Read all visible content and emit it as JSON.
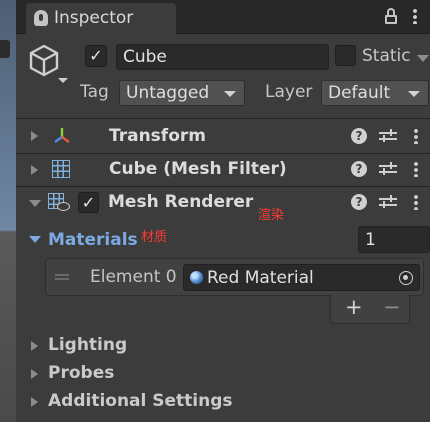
{
  "window": {
    "tab_title": "Inspector"
  },
  "header": {
    "active": true,
    "object_name": "Cube",
    "static_label": "Static",
    "static_checked": false,
    "tag_label": "Tag",
    "tag_value": "Untagged",
    "layer_label": "Layer",
    "layer_value": "Default"
  },
  "components": [
    {
      "title": "Transform",
      "icon": "transform-axes-icon"
    },
    {
      "title": "Cube (Mesh Filter)",
      "icon": "mesh-grid-icon"
    },
    {
      "title": "Mesh Renderer",
      "icon": "mesh-renderer-icon",
      "enabled": true,
      "annotation": "渲染"
    }
  ],
  "materials": {
    "label": "Materials",
    "annotation": "材质",
    "count": "1",
    "element_label": "Element 0",
    "element_value": "Red Material",
    "add_symbol": "+",
    "remove_symbol": "−"
  },
  "sections": [
    "Lighting",
    "Probes",
    "Additional Settings"
  ],
  "colors": {
    "panel_bg": "#3c3c3c",
    "accent_blue": "#7da9e3",
    "annotation_red": "#ff3b30"
  }
}
